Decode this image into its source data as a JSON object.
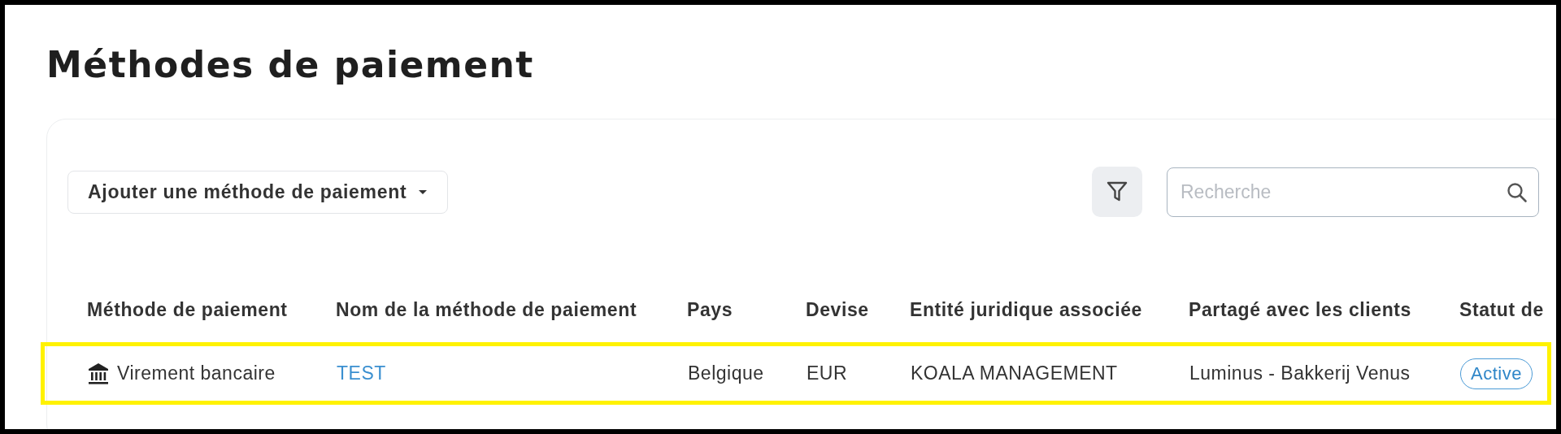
{
  "page": {
    "title": "Méthodes de paiement"
  },
  "toolbar": {
    "add_button": "Ajouter une méthode de paiement",
    "search": {
      "placeholder": "Recherche"
    }
  },
  "table": {
    "columns": [
      "Méthode de paiement",
      "Nom de la méthode de paiement",
      "Pays",
      "Devise",
      "Entité juridique associée",
      "Partagé avec les clients",
      "Statut de"
    ],
    "rows": [
      {
        "highlighted": true,
        "method": "Virement bancaire",
        "name": "TEST",
        "country": "Belgique",
        "currency": "EUR",
        "entity": "KOALA MANAGEMENT",
        "shared_with": "Luminus - Bakkerij Venus",
        "status": "Active"
      }
    ]
  }
}
